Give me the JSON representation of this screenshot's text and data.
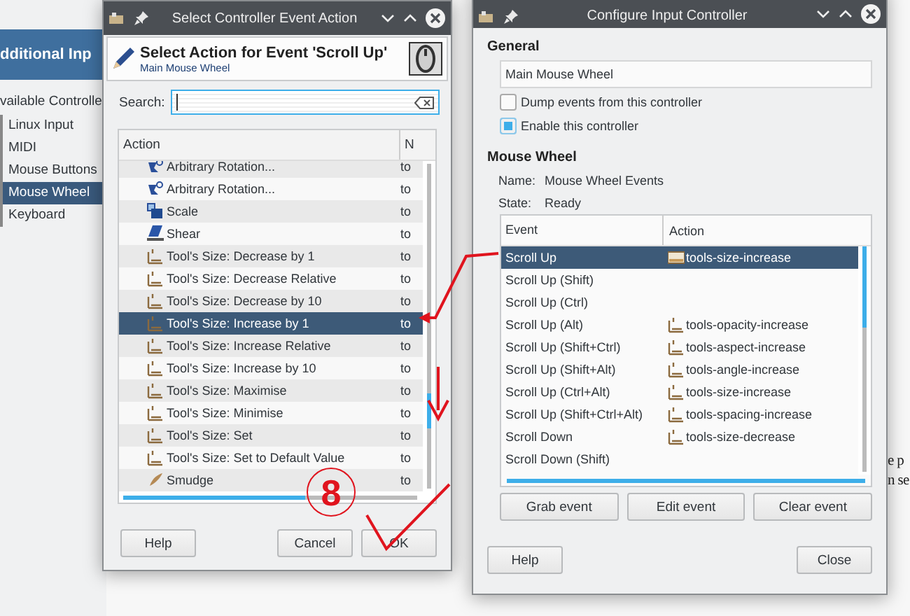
{
  "background": {
    "header": "dditional Inp",
    "section_label": "vailable Controlle",
    "controllers": [
      {
        "label": "Linux Input",
        "selected": false
      },
      {
        "label": "MIDI",
        "selected": false
      },
      {
        "label": "Mouse Buttons",
        "selected": false
      },
      {
        "label": "Mouse Wheel",
        "selected": true
      },
      {
        "label": "Keyboard",
        "selected": false
      }
    ],
    "side_text": [
      "e p",
      "n se"
    ]
  },
  "action_dialog": {
    "title": "Select Controller Event Action",
    "heading": "Select Action for Event 'Scroll Up'",
    "subheading": "Main Mouse Wheel",
    "search": {
      "label": "Search:"
    },
    "columns": [
      "Action",
      "N"
    ],
    "rows": [
      {
        "kind": "rotate",
        "action": "Arbitrary Rotation...",
        "column_2": "to",
        "selected": false
      },
      {
        "kind": "rotate",
        "action": "Arbitrary Rotation...",
        "column_2": "to",
        "selected": false
      },
      {
        "kind": "scale",
        "action": "Scale",
        "column_2": "to",
        "selected": false
      },
      {
        "kind": "shear",
        "action": "Shear",
        "column_2": "to",
        "selected": false
      },
      {
        "kind": "tool",
        "action": "Tool's Size: Decrease by 1",
        "column_2": "to",
        "selected": false
      },
      {
        "kind": "tool",
        "action": "Tool's Size: Decrease Relative",
        "column_2": "to",
        "selected": false
      },
      {
        "kind": "tool",
        "action": "Tool's Size: Decrease by 10",
        "column_2": "to",
        "selected": false
      },
      {
        "kind": "tool",
        "action": "Tool's Size: Increase by 1",
        "column_2": "to",
        "selected": true
      },
      {
        "kind": "tool",
        "action": "Tool's Size: Increase Relative",
        "column_2": "to",
        "selected": false
      },
      {
        "kind": "tool",
        "action": "Tool's Size: Increase by 10",
        "column_2": "to",
        "selected": false
      },
      {
        "kind": "tool",
        "action": "Tool's Size: Maximise",
        "column_2": "to",
        "selected": false
      },
      {
        "kind": "tool",
        "action": "Tool's Size: Minimise",
        "column_2": "to",
        "selected": false
      },
      {
        "kind": "tool",
        "action": "Tool's Size: Set",
        "column_2": "to",
        "selected": false
      },
      {
        "kind": "tool",
        "action": "Tool's Size: Set to Default Value",
        "column_2": "to",
        "selected": false
      },
      {
        "kind": "smudge",
        "action": "Smudge",
        "column_2": "to",
        "selected": false
      }
    ],
    "buttons": [
      "Help",
      "Cancel",
      "OK"
    ]
  },
  "config_dialog": {
    "title": "Configure Input Controller",
    "general_label": "General",
    "name_field": "Main Mouse Wheel",
    "checkboxes": [
      {
        "label": "Dump events from this controller",
        "checked": false
      },
      {
        "label": "Enable this controller",
        "checked": true
      }
    ],
    "section_label": "Mouse Wheel",
    "info": [
      {
        "label": "Name:",
        "value": "Mouse Wheel Events"
      },
      {
        "label": "State:",
        "value": "Ready"
      }
    ],
    "columns": [
      "Event",
      "Action"
    ],
    "rows": [
      {
        "event": "Scroll Up",
        "action": "tools-size-increase",
        "selected": true
      },
      {
        "event": "Scroll Up (Shift)",
        "selected": false
      },
      {
        "event": "Scroll Up (Ctrl)",
        "selected": false
      },
      {
        "event": "Scroll Up (Alt)",
        "action": "tools-opacity-increase",
        "selected": false
      },
      {
        "event": "Scroll Up (Shift+Ctrl)",
        "action": "tools-aspect-increase",
        "selected": false
      },
      {
        "event": "Scroll Up (Shift+Alt)",
        "action": "tools-angle-increase",
        "selected": false
      },
      {
        "event": "Scroll Up (Ctrl+Alt)",
        "action": "tools-size-increase",
        "selected": false
      },
      {
        "event": "Scroll Up (Shift+Ctrl+Alt)",
        "action": "tools-spacing-increase",
        "selected": false
      },
      {
        "event": "Scroll Down",
        "action": "tools-size-decrease",
        "selected": false
      },
      {
        "event": "Scroll Down (Shift)",
        "selected": false
      }
    ],
    "event_buttons": [
      "Grab event",
      "Edit event",
      "Clear event"
    ],
    "buttons": [
      "Help",
      "Close"
    ]
  },
  "annotation": {
    "number": "8"
  }
}
